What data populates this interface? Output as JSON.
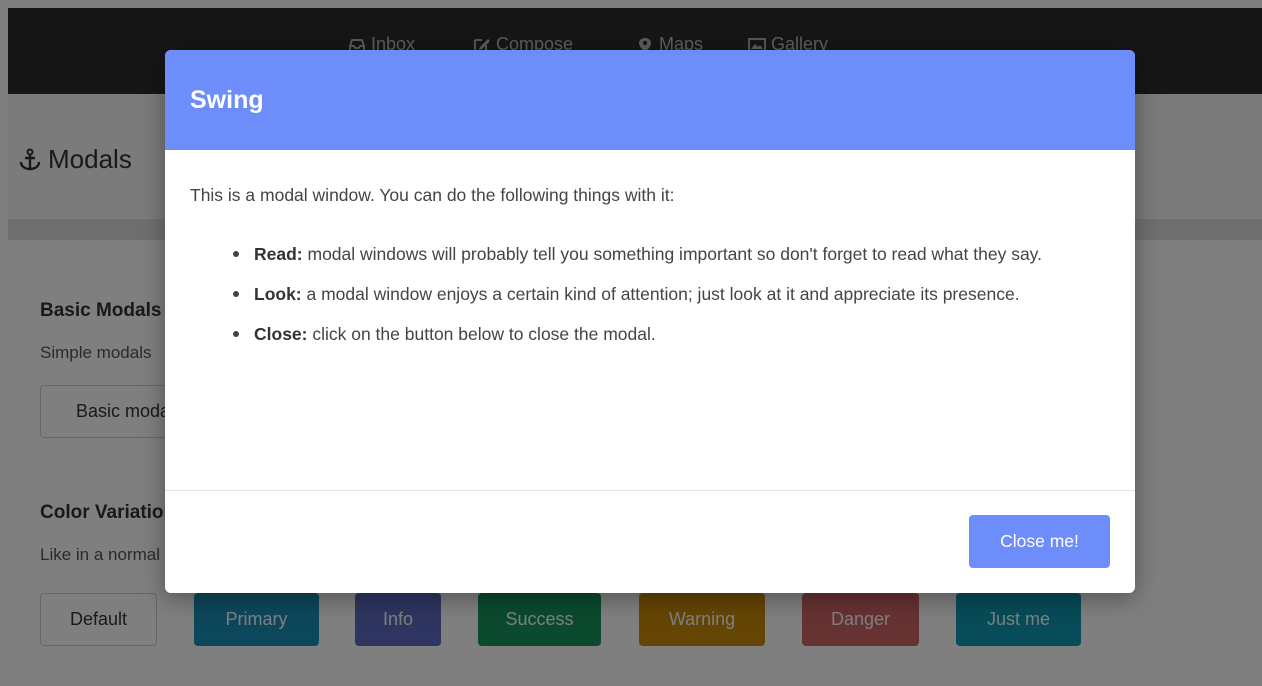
{
  "nav": {
    "items": [
      {
        "label": "Inbox",
        "icon": "inbox-icon"
      },
      {
        "label": "Compose",
        "icon": "edit-icon"
      },
      {
        "label": "Maps",
        "icon": "map-marker-icon"
      },
      {
        "label": "Gallery",
        "icon": "image-icon"
      }
    ]
  },
  "header": {
    "title": "Modals",
    "icon": "anchor-icon"
  },
  "basic": {
    "title": "Basic Modals",
    "desc": "Simple modals",
    "button_label": "Basic modal"
  },
  "colors": {
    "title": "Color Variations",
    "desc": "Like in a normal",
    "buttons": [
      {
        "label": "Default",
        "color": "#ffffff"
      },
      {
        "label": "Primary",
        "color": "#1b8fb6"
      },
      {
        "label": "Info",
        "color": "#5c6bc0"
      },
      {
        "label": "Success",
        "color": "#16955f"
      },
      {
        "label": "Warning",
        "color": "#c98a06"
      },
      {
        "label": "Danger",
        "color": "#cf6464"
      },
      {
        "label": "Just me",
        "color": "#0f98b0"
      }
    ]
  },
  "modal": {
    "title": "Swing",
    "accent": "#6d8dfb",
    "intro": "This is a modal window. You can do the following things with it:",
    "items": [
      {
        "label": "Read:",
        "text": " modal windows will probably tell you something important so don't forget to read what they say."
      },
      {
        "label": "Look:",
        "text": " a modal window enjoys a certain kind of attention; just look at it and appreciate its presence."
      },
      {
        "label": "Close:",
        "text": " click on the button below to close the modal."
      }
    ],
    "close_label": "Close me!"
  }
}
